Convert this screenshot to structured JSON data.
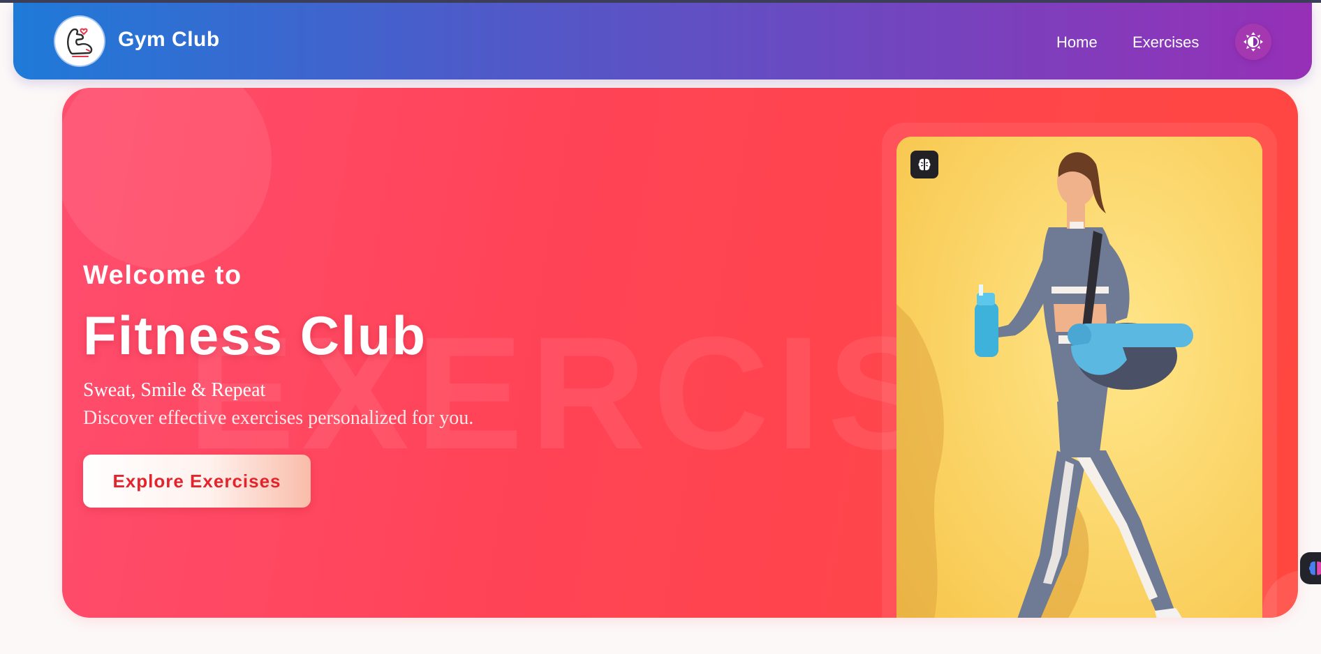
{
  "header": {
    "brand": "Gym Club",
    "logo_icon": "flexed-arm-icon",
    "nav": [
      {
        "label": "Home"
      },
      {
        "label": "Exercises"
      }
    ],
    "theme_toggle_icon": "sun-icon",
    "colors": {
      "gradient_start": "#1f7ad8",
      "gradient_end": "#9630b7"
    }
  },
  "hero": {
    "welcome": "Welcome to",
    "title": "Fitness Club",
    "tagline": "Sweat, Smile & Repeat",
    "description": "Discover effective exercises personalized for you.",
    "cta_label": "Explore Exercises",
    "watermark": "EXERCIS",
    "image_badge_icon": "brain-icon",
    "image_subject": "woman-walking-with-gym-bag-icon",
    "colors": {
      "background_start": "#ff4d6e",
      "background_end": "#ff473f",
      "cta_text": "#e4232c",
      "image_bg": "#fbd96a"
    }
  },
  "floating_badge_icon": "brain-icon"
}
